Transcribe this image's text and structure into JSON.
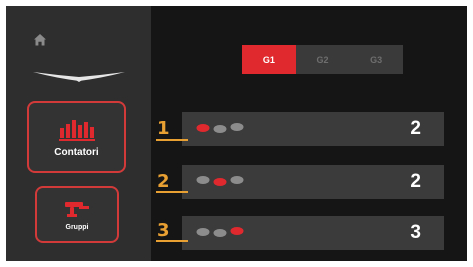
{
  "sidebar": {
    "nav": [
      {
        "label": "Contatori",
        "icon": "bar-chart-icon",
        "active": true
      },
      {
        "label": "Gruppi",
        "icon": "wrench-icon",
        "active": false
      }
    ]
  },
  "group_selector": {
    "tabs": [
      {
        "label": "G1",
        "active": true
      },
      {
        "label": "G2",
        "active": false
      },
      {
        "label": "G3",
        "active": false
      }
    ]
  },
  "counter_rows": [
    {
      "callout": "1",
      "active_dot": 1,
      "value": "2"
    },
    {
      "callout": "2",
      "active_dot": 2,
      "value": "2"
    },
    {
      "callout": "3",
      "active_dot": 3,
      "value": "3"
    }
  ],
  "colors": {
    "accent_red": "#e0292e",
    "callout_orange": "#e8a033",
    "panel_bg": "#151515",
    "sidebar_bg": "#2e2e2e",
    "row_bg": "#3b3b3b"
  }
}
